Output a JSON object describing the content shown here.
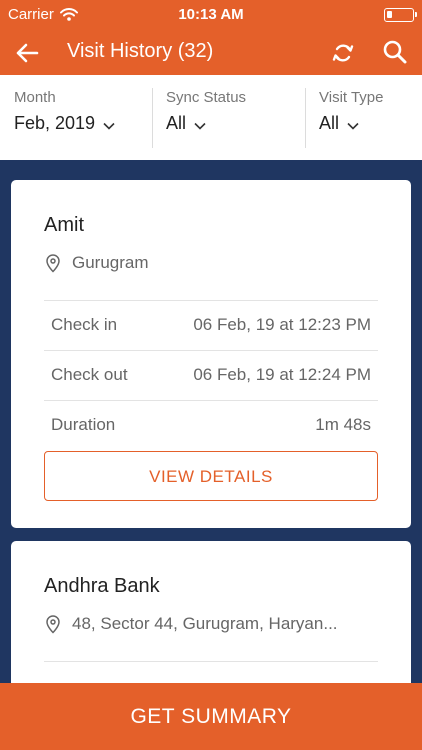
{
  "status_bar": {
    "carrier": "Carrier",
    "time": "10:13 AM"
  },
  "header": {
    "title": "Visit History (32)"
  },
  "icons": {
    "back": "arrow-left-icon",
    "sync": "sync-icon",
    "search": "search-icon",
    "location": "location-pin-icon",
    "chevron": "chevron-down-icon"
  },
  "filters": [
    {
      "label": "Month",
      "value": "Feb, 2019"
    },
    {
      "label": "Sync Status",
      "value": "All"
    },
    {
      "label": "Visit Type",
      "value": "All"
    }
  ],
  "visits": [
    {
      "name": "Amit",
      "location": "Gurugram",
      "rows": [
        {
          "label": "Check in",
          "value": "06 Feb, 19 at 12:23 PM"
        },
        {
          "label": "Check out",
          "value": "06 Feb, 19 at 12:24 PM"
        },
        {
          "label": "Duration",
          "value": "1m 48s"
        }
      ],
      "action_label": "VIEW DETAILS"
    },
    {
      "name": "Andhra Bank",
      "location": "48, Sector 44, Gurugram, Haryan..."
    }
  ],
  "footer": {
    "summary_label": "GET SUMMARY"
  },
  "colors": {
    "primary": "#e4602a",
    "background": "#1f3661",
    "card": "#ffffff"
  }
}
